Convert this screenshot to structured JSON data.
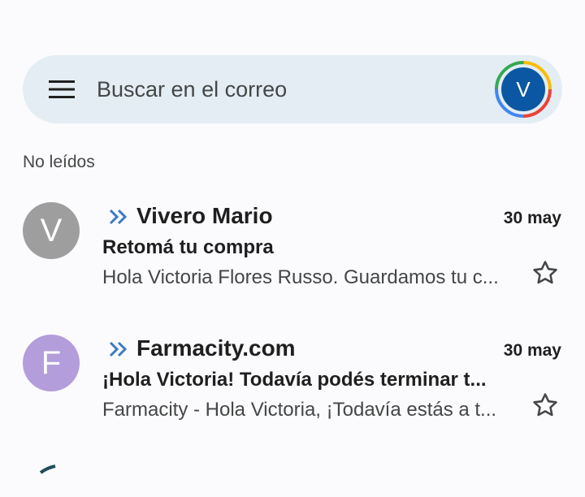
{
  "search": {
    "placeholder": "Buscar en el correo"
  },
  "account": {
    "initial": "V",
    "avatar_color": "#0b57a4"
  },
  "inbox": {
    "section_label": "No leídos",
    "emails": [
      {
        "avatar_initial": "V",
        "avatar_color": "#9e9e9e",
        "sender": "Vivero Mario",
        "date": "30 may",
        "subject": "Retomá tu compra",
        "snippet": "Hola Victoria Flores Russo. Guardamos tu c...",
        "starred": false
      },
      {
        "avatar_initial": "F",
        "avatar_color": "#b39ddb",
        "sender": "Farmacity.com",
        "date": "30 may",
        "subject": "¡Hola Victoria! Todavía podés terminar t...",
        "snippet": "Farmacity - Hola Victoria, ¡Todavía estás a t...",
        "starred": false
      }
    ]
  },
  "colors": {
    "background": "#fbfbfe",
    "search_bar": "#e3edf3",
    "importance_marker": "#3b7bc4"
  }
}
